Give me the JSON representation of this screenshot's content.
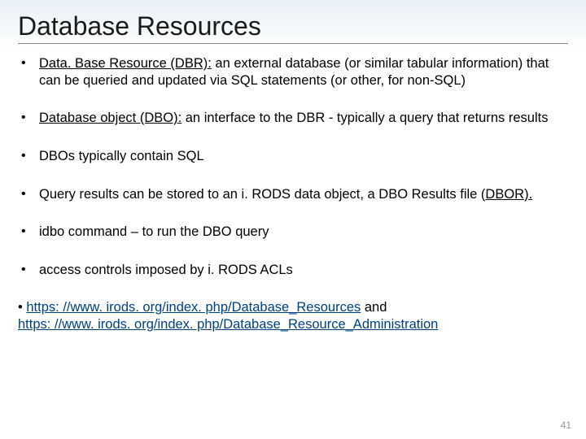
{
  "slide": {
    "title": "Database Resources",
    "page_number": "41"
  },
  "bullets": {
    "b1_a": "Data. Base Resource (DBR):",
    "b1_b": " an external database (or similar tabular information) that can be queried and updated via SQL statements (or other, for non-SQL)",
    "b2_a": "Database object (DBO):",
    "b2_b": " an interface to the DBR - typically a query that returns results",
    "b3": "DBOs typically contain SQL",
    "b4_a": "Query results can be stored to an i. RODS data object, a DBO Results file (",
    "b4_b": "DBOR).",
    "b5": "idbo command – to run the DBO query",
    "b6": "access controls imposed by i. RODS ACLs"
  },
  "links": {
    "bullet": "•   ",
    "link1": "https: //www. irods. org/index. php/Database_Resources",
    "and": " and ",
    "link2": "https: //www. irods. org/index. php/Database_Resource_Administration"
  }
}
